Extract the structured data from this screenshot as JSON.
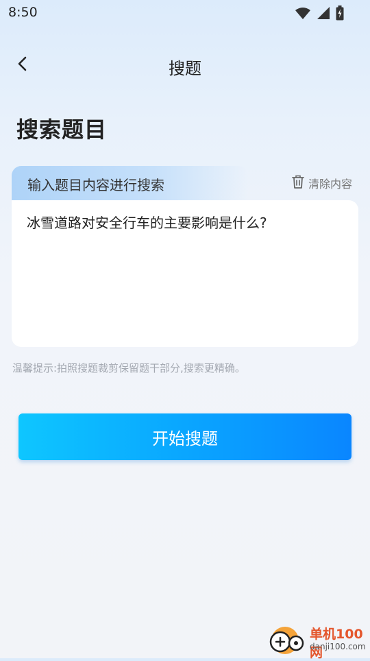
{
  "status_bar": {
    "time": "8:50"
  },
  "header": {
    "title": "搜题"
  },
  "section": {
    "title": "搜索题目"
  },
  "input_card": {
    "tab_label": "输入题目内容进行搜索",
    "clear_label": "清除内容",
    "question_value": "冰雪道路对安全行车的主要影响是什么?"
  },
  "tip": {
    "text": "温馨提示:拍照搜题裁剪保留题干部分,搜索更精确。"
  },
  "start_button": {
    "label": "开始搜题"
  },
  "watermark": {
    "title": "单机100网",
    "url": "danji100.com"
  },
  "colors": {
    "accent_start": "#0ec6ff",
    "accent_end": "#0a86ff",
    "tab_bg": "#aed3f8",
    "watermark": "#e4572e"
  },
  "icons": [
    "wifi-icon",
    "signal-icon",
    "battery-icon",
    "back-arrow-icon",
    "trash-icon",
    "logo-icon"
  ]
}
